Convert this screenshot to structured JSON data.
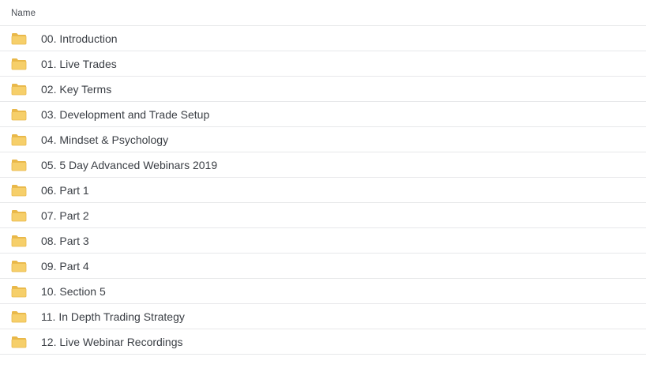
{
  "table": {
    "column_header": "Name",
    "folder_icon": "folder-icon",
    "folder_color": "#f6cf6a",
    "folder_edge_color": "#e9b849",
    "items": [
      {
        "name": "00. Introduction"
      },
      {
        "name": "01. Live Trades"
      },
      {
        "name": "02. Key Terms"
      },
      {
        "name": "03. Development and Trade Setup"
      },
      {
        "name": "04. Mindset & Psychology"
      },
      {
        "name": "05. 5 Day Advanced Webinars 2019"
      },
      {
        "name": "06. Part 1"
      },
      {
        "name": "07. Part 2"
      },
      {
        "name": "08. Part 3"
      },
      {
        "name": "09. Part 4"
      },
      {
        "name": "10. Section 5"
      },
      {
        "name": "11. In Depth Trading Strategy"
      },
      {
        "name": "12. Live Webinar Recordings"
      }
    ]
  }
}
